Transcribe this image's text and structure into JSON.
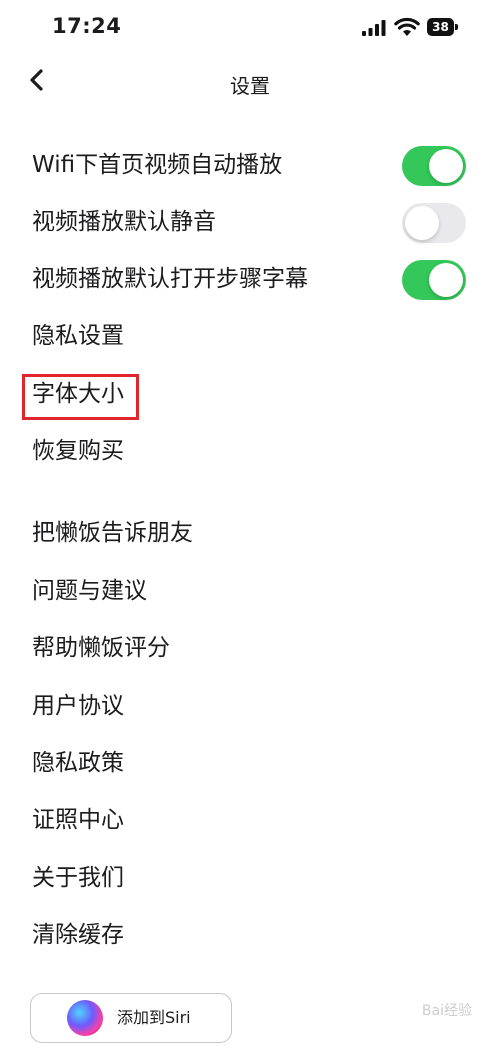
{
  "status_bar": {
    "time": "17:24",
    "battery": "38"
  },
  "nav": {
    "title": "设置"
  },
  "settings": {
    "wifi_autoplay": {
      "label": "Wifi下首页视频自动播放",
      "on": true
    },
    "mute_default": {
      "label": "视频播放默认静音",
      "on": false
    },
    "step_subtitles": {
      "label": "视频播放默认打开步骤字幕",
      "on": true
    },
    "privacy_settings": "隐私设置",
    "font_size": "字体大小",
    "restore_purchase": "恢复购买",
    "share_friends": "把懒饭告诉朋友",
    "feedback": "问题与建议",
    "rate_app": "帮助懒饭评分",
    "user_agreement": "用户协议",
    "privacy_policy": "隐私政策",
    "license_center": "证照中心",
    "about_us": "关于我们",
    "clear_cache": "清除缓存"
  },
  "siri": {
    "label": "添加到Siri"
  },
  "watermark": "Bai经验"
}
